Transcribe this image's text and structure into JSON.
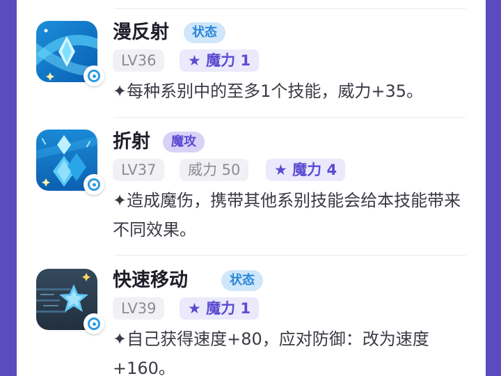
{
  "skills": [
    {
      "name": "漫反射",
      "type": "状态",
      "level": "LV36",
      "power": "",
      "magic": "★ 魔力 1",
      "description": "✦每种系别中的至多1个技能，威力+35。",
      "icon": "crystal-swirl-icon"
    },
    {
      "name": "折射",
      "type": "魔攻",
      "level": "LV37",
      "power": "威力 50",
      "magic": "★ 魔力 4",
      "description": "✦造成魔伤，携带其他系别技能会给本技能带来不同效果。",
      "icon": "crystal-refraction-icon"
    },
    {
      "name": "快速移动",
      "type": "状态",
      "level": "LV39",
      "power": "",
      "magic": "★ 魔力 1",
      "description": "✦自己获得速度+80，应对防御：改为速度+160。",
      "icon": "speed-star-icon"
    }
  ],
  "colors": {
    "background": "#5a4cbf",
    "status_tag": "#2a86d6",
    "magic_tag": "#5b4bd1"
  }
}
